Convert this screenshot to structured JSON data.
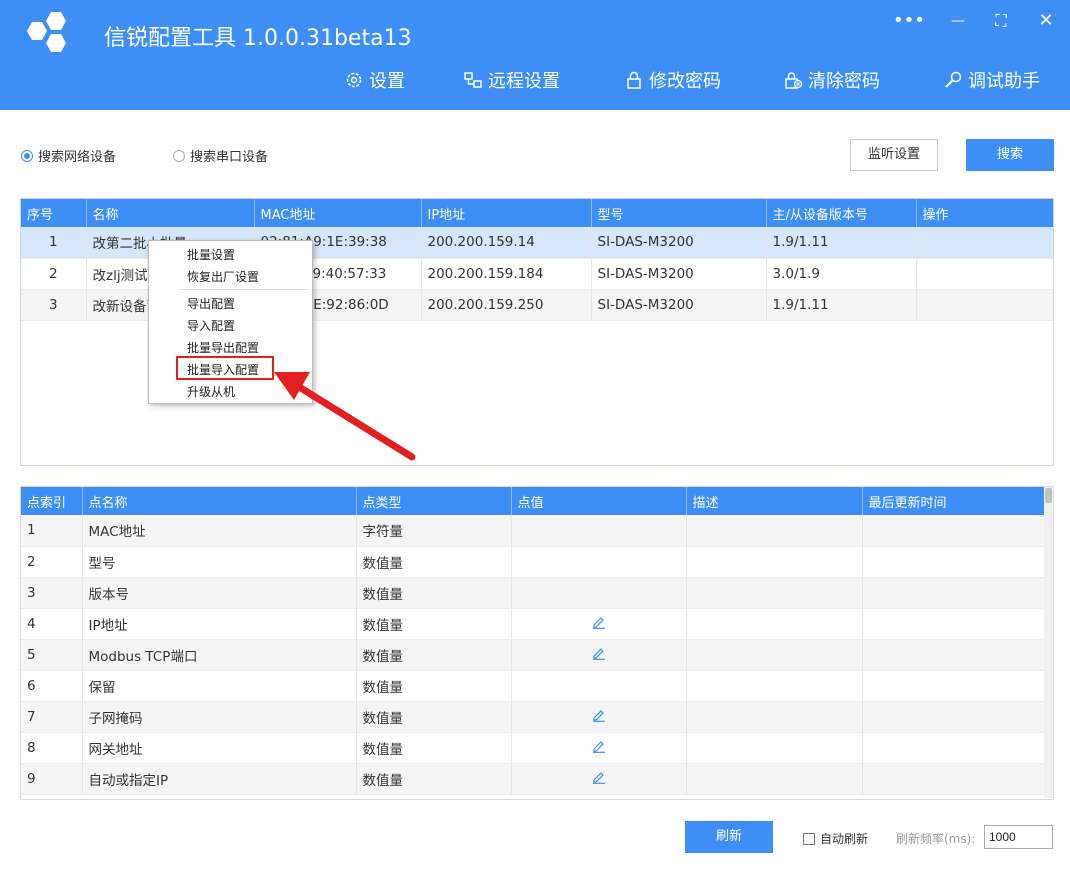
{
  "app": {
    "title": "信锐配置工具 1.0.0.31beta13"
  },
  "window_controls": {
    "more": "•••",
    "minimize": "—",
    "maximize": "⛶",
    "close": "✕"
  },
  "nav": [
    {
      "label": "设置",
      "icon": "gear-icon"
    },
    {
      "label": "远程设置",
      "icon": "remote-icon"
    },
    {
      "label": "修改密码",
      "icon": "lock-icon"
    },
    {
      "label": "清除密码",
      "icon": "clear-lock-icon"
    },
    {
      "label": "调试助手",
      "icon": "debug-icon"
    }
  ],
  "search": {
    "radio_network": "搜索网络设备",
    "radio_serial": "搜索串口设备",
    "monitor_button": "监听设置",
    "search_button": "搜索"
  },
  "device_table": {
    "headers": [
      "序号",
      "名称",
      "MAC地址",
      "IP地址",
      "型号",
      "主/从设备版本号",
      "操作"
    ],
    "rows": [
      {
        "no": "1",
        "name": "改第二批小批量",
        "mac": "02:81:A9:1E:39:38",
        "ip": "200.200.159.14",
        "model": "SI-DAS-M3200",
        "version": "1.9/1.11",
        "op": ""
      },
      {
        "no": "2",
        "name": "改zlj测试串口",
        "mac": "02:81:69:40:57:33",
        "ip": "200.200.159.184",
        "model": "SI-DAS-M3200",
        "version": "3.0/1.9",
        "op": ""
      },
      {
        "no": "3",
        "name": "改新设备蓄电",
        "mac": "02:81:AE:92:86:0D",
        "ip": "200.200.159.250",
        "model": "SI-DAS-M3200",
        "version": "1.9/1.11",
        "op": ""
      }
    ]
  },
  "context_menu": {
    "items": [
      "批量设置",
      "恢复出厂设置",
      "导出配置",
      "导入配置",
      "批量导出配置",
      "批量导入配置",
      "升级从机"
    ]
  },
  "points_table": {
    "headers": [
      "点索引",
      "点名称",
      "点类型",
      "点值",
      "描述",
      "最后更新时间"
    ],
    "rows": [
      {
        "idx": "1",
        "name": "MAC地址",
        "type": "字符量",
        "value": "",
        "desc": "",
        "time": "",
        "editable": false
      },
      {
        "idx": "2",
        "name": "型号",
        "type": "数值量",
        "value": "",
        "desc": "",
        "time": "",
        "editable": false
      },
      {
        "idx": "3",
        "name": "版本号",
        "type": "数值量",
        "value": "",
        "desc": "",
        "time": "",
        "editable": false
      },
      {
        "idx": "4",
        "name": "IP地址",
        "type": "数值量",
        "value": "",
        "desc": "",
        "time": "",
        "editable": true
      },
      {
        "idx": "5",
        "name": "Modbus TCP端口",
        "type": "数值量",
        "value": "",
        "desc": "",
        "time": "",
        "editable": true
      },
      {
        "idx": "6",
        "name": "保留",
        "type": "数值量",
        "value": "",
        "desc": "",
        "time": "",
        "editable": false
      },
      {
        "idx": "7",
        "name": "子网掩码",
        "type": "数值量",
        "value": "",
        "desc": "",
        "time": "",
        "editable": true
      },
      {
        "idx": "8",
        "name": "网关地址",
        "type": "数值量",
        "value": "",
        "desc": "",
        "time": "",
        "editable": true
      },
      {
        "idx": "9",
        "name": "自动或指定IP",
        "type": "数值量",
        "value": "",
        "desc": "",
        "time": "",
        "editable": true
      }
    ]
  },
  "footer": {
    "refresh_button": "刷新",
    "auto_refresh": "自动刷新",
    "rate_label": "刷新频率(ms):",
    "rate_value": "1000"
  },
  "colors": {
    "primary": "#3d8ff5",
    "header_bg": "#3d8ff5",
    "selected_row": "#d7e6fa",
    "highlight": "#e32020"
  }
}
